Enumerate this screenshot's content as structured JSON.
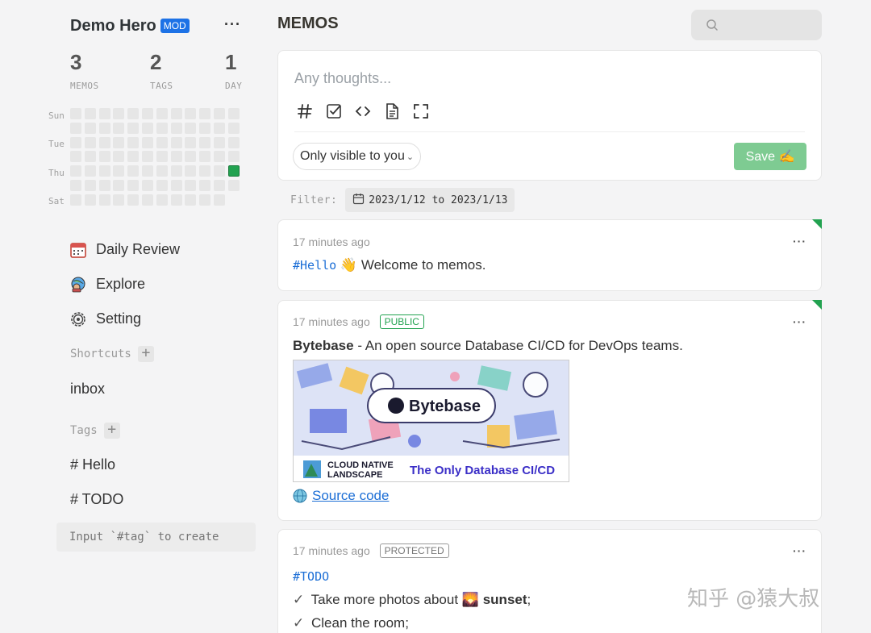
{
  "sidebar": {
    "user": {
      "name": "Demo Hero",
      "badge": "MOD",
      "more_label": "···"
    },
    "stats": [
      {
        "value": "3",
        "label": "MEMOS"
      },
      {
        "value": "2",
        "label": "TAGS"
      },
      {
        "value": "1",
        "label": "DAY"
      }
    ],
    "heatmap": {
      "day_labels": [
        "Sun",
        "Tue",
        "Thu",
        "Sat"
      ],
      "active_color": "#22a250"
    },
    "nav": [
      {
        "label": "Daily Review",
        "icon": "calendar-icon"
      },
      {
        "label": "Explore",
        "icon": "explore-icon"
      },
      {
        "label": "Setting",
        "icon": "gear-icon"
      }
    ],
    "shortcuts_title": "Shortcuts",
    "shortcuts": [
      "inbox"
    ],
    "tags_title": "Tags",
    "tags": [
      "# Hello",
      "# TODO"
    ],
    "tag_input_placeholder": "Input `#tag` to create"
  },
  "main": {
    "title": "MEMOS",
    "search": {
      "placeholder": ""
    },
    "editor": {
      "placeholder": "Any thoughts...",
      "tools": [
        "hash-icon",
        "checkbox-icon",
        "code-icon",
        "document-icon",
        "fullscreen-icon"
      ],
      "visibility": "Only visible to you",
      "save_label": "Save ✍️"
    },
    "filter": {
      "label": "Filter:",
      "value": "2023/1/12 to 2023/1/13"
    },
    "memos": [
      {
        "time": "17 minutes ago",
        "tag": "#Hello",
        "emoji": "👋",
        "text": "Welcome to memos.",
        "more": "···"
      },
      {
        "time": "17 minutes ago",
        "visibility": "PUBLIC",
        "bold": "Bytebase",
        "text": " - An open source Database CI/CD for DevOps teams.",
        "image": {
          "brand": "Bytebase",
          "footer_line1": "CLOUD NATIVE",
          "footer_line2": "LANDSCAPE",
          "footer_tagline": "The Only Database CI/CD"
        },
        "link": "Source code",
        "more": "···"
      },
      {
        "time": "17 minutes ago",
        "visibility": "PROTECTED",
        "tag": "#TODO",
        "todo1_prefix": "Take more photos about",
        "todo1_emoji": "🌄",
        "todo1_bold": "sunset",
        "todo1_suffix": ";",
        "todo2": "Clean the room;",
        "more": "···"
      }
    ]
  },
  "watermark": "知乎 @猿大叔",
  "colors": {
    "accent_blue": "#1d72e6",
    "green": "#22a250",
    "save_green": "#7ecb92"
  }
}
